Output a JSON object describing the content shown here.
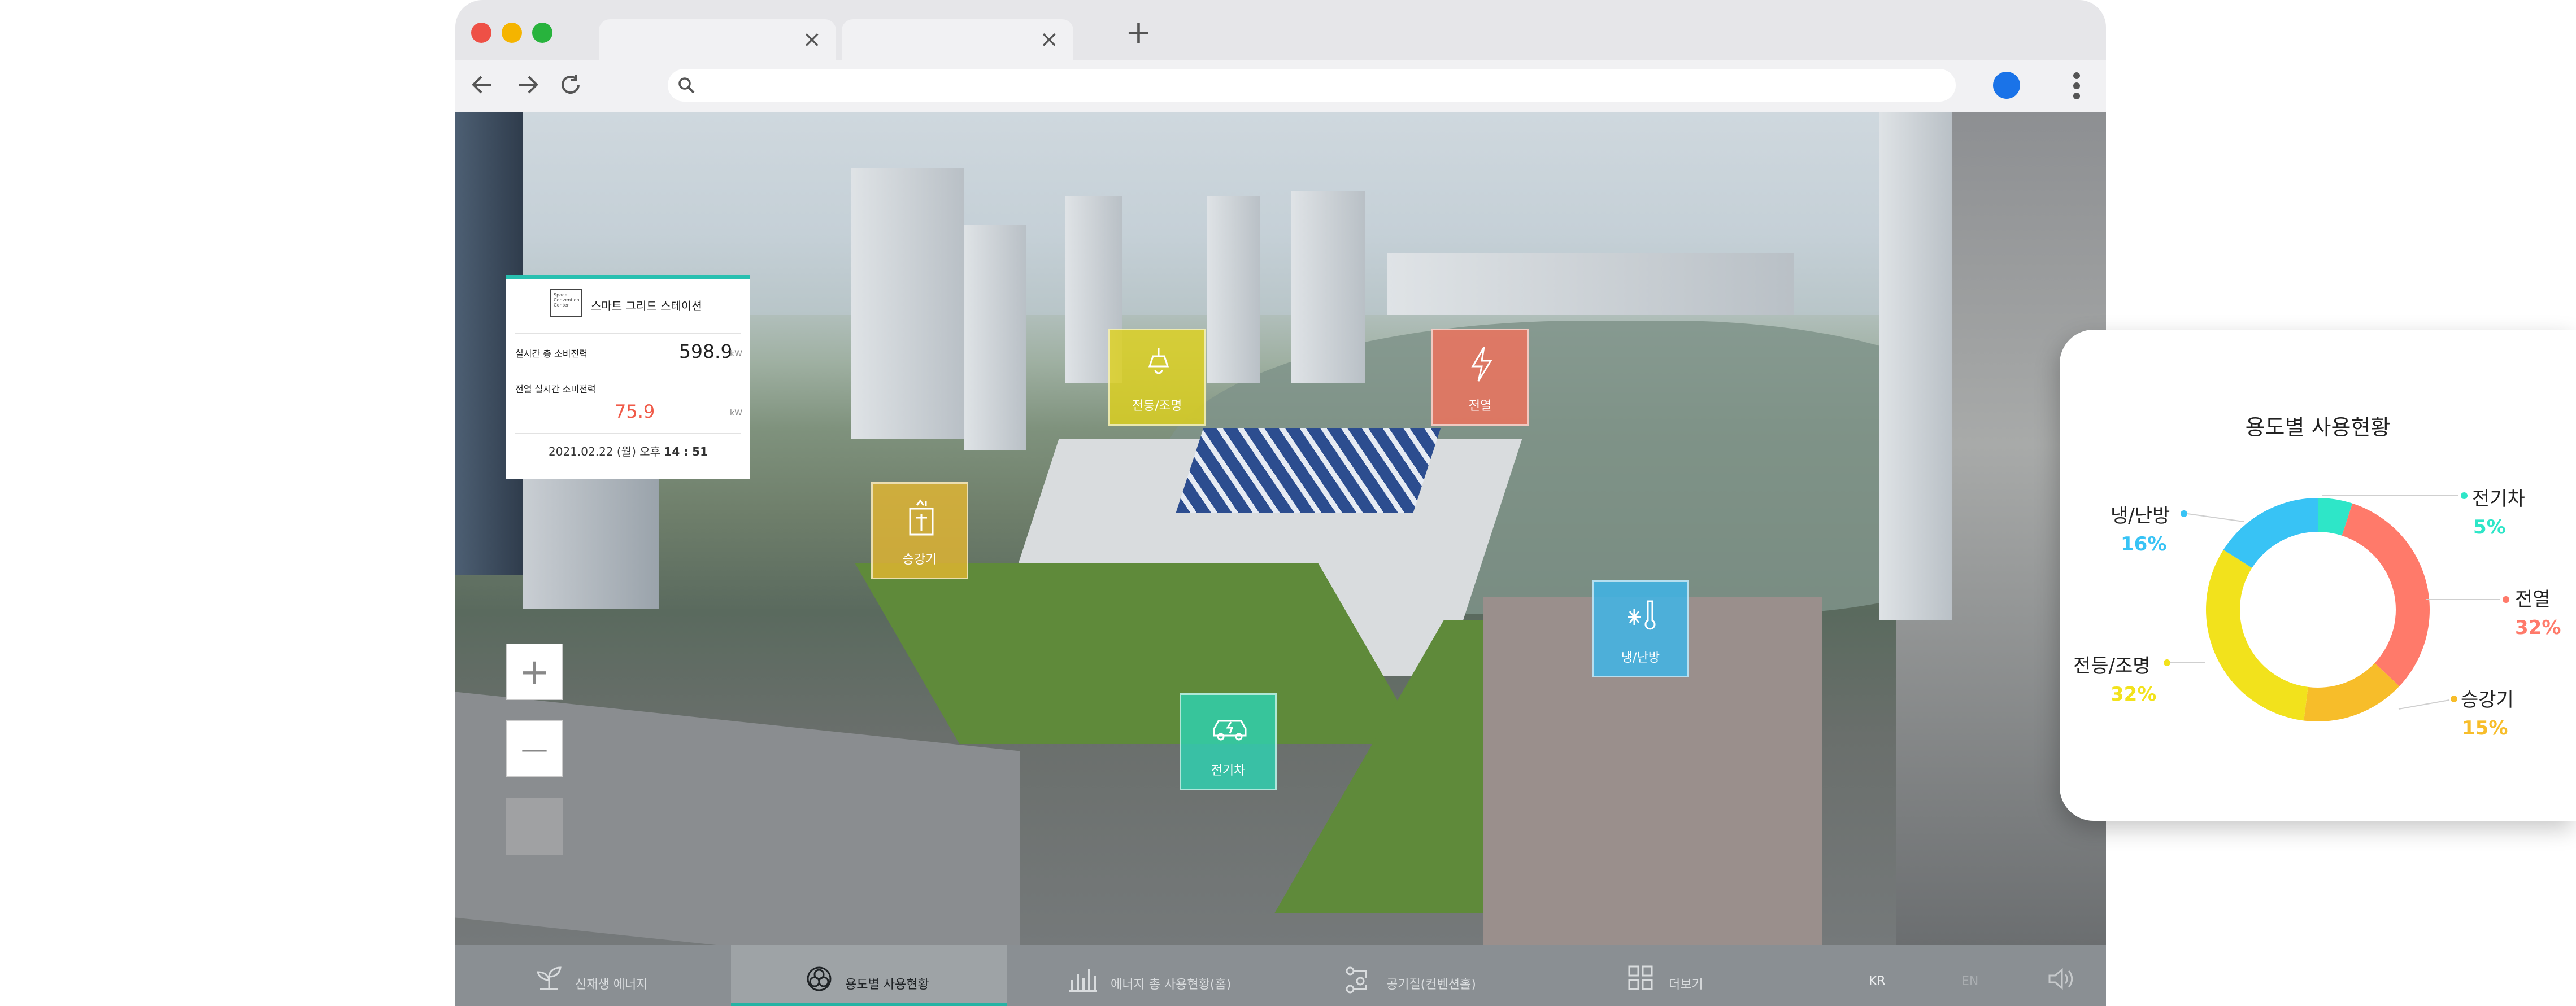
{
  "browser": {
    "traffic_colors": [
      "#ee5046",
      "#f5b400",
      "#28b33d"
    ],
    "tabs": [
      {
        "close": "×"
      },
      {
        "close": "×"
      }
    ],
    "newtab": "+",
    "address_placeholder": ""
  },
  "panel": {
    "title": "스마트 그리드 스테이션",
    "logo_text": "Space Convention Center",
    "total_label": "실시간 총 소비전력",
    "total_value": "598.9",
    "total_unit": "kW",
    "heat_label": "전열 실시간 소비전력",
    "heat_value": "75.9",
    "heat_unit": "kW",
    "datetime_prefix": "2021.02.22 (월) 오후",
    "datetime_time": "14 : 51"
  },
  "zoom": {
    "plus": "+",
    "minus": "—"
  },
  "markers": {
    "lighting": {
      "label": "전등/조명",
      "icon": "lamp-icon",
      "color": "#e0d21a"
    },
    "heat": {
      "label": "전열",
      "icon": "lightning-icon",
      "color": "#f0725b"
    },
    "elevator": {
      "label": "승강기",
      "icon": "elevator-icon",
      "color": "#e8b930"
    },
    "hvac": {
      "label": "냉/난방",
      "icon": "snowflake-thermometer-icon",
      "color": "#3cb6ea"
    },
    "ev": {
      "label": "전기차",
      "icon": "electric-car-icon",
      "color": "#2ed2b1"
    }
  },
  "bottom_nav": {
    "items": [
      {
        "label": "신재생 에너지",
        "icon": "plant-icon"
      },
      {
        "label": "용도별 사용현황",
        "icon": "usage-icon",
        "active": true
      },
      {
        "label": "에너지 총 사용현황(홈)",
        "icon": "bar-chart-icon"
      },
      {
        "label": "공기질(컨벤션홀)",
        "icon": "air-quality-icon"
      },
      {
        "label": "더보기",
        "icon": "grid-icon"
      }
    ],
    "lang_kr": "KR",
    "lang_en": "EN",
    "sound_icon": "speaker-icon"
  },
  "usage_card": {
    "title": "용도별 사용현황",
    "segments": [
      {
        "label": "전기차",
        "pct": "5%",
        "value": 5,
        "color": "#2ee6c8"
      },
      {
        "label": "전열",
        "pct": "32%",
        "value": 32,
        "color": "#ff7a6a"
      },
      {
        "label": "승강기",
        "pct": "15%",
        "value": 15,
        "color": "#f7bd2a"
      },
      {
        "label": "전등/조명",
        "pct": "32%",
        "value": 32,
        "color": "#f2e21c"
      },
      {
        "label": "냉/난방",
        "pct": "16%",
        "value": 16,
        "color": "#38c3f5"
      }
    ]
  }
}
